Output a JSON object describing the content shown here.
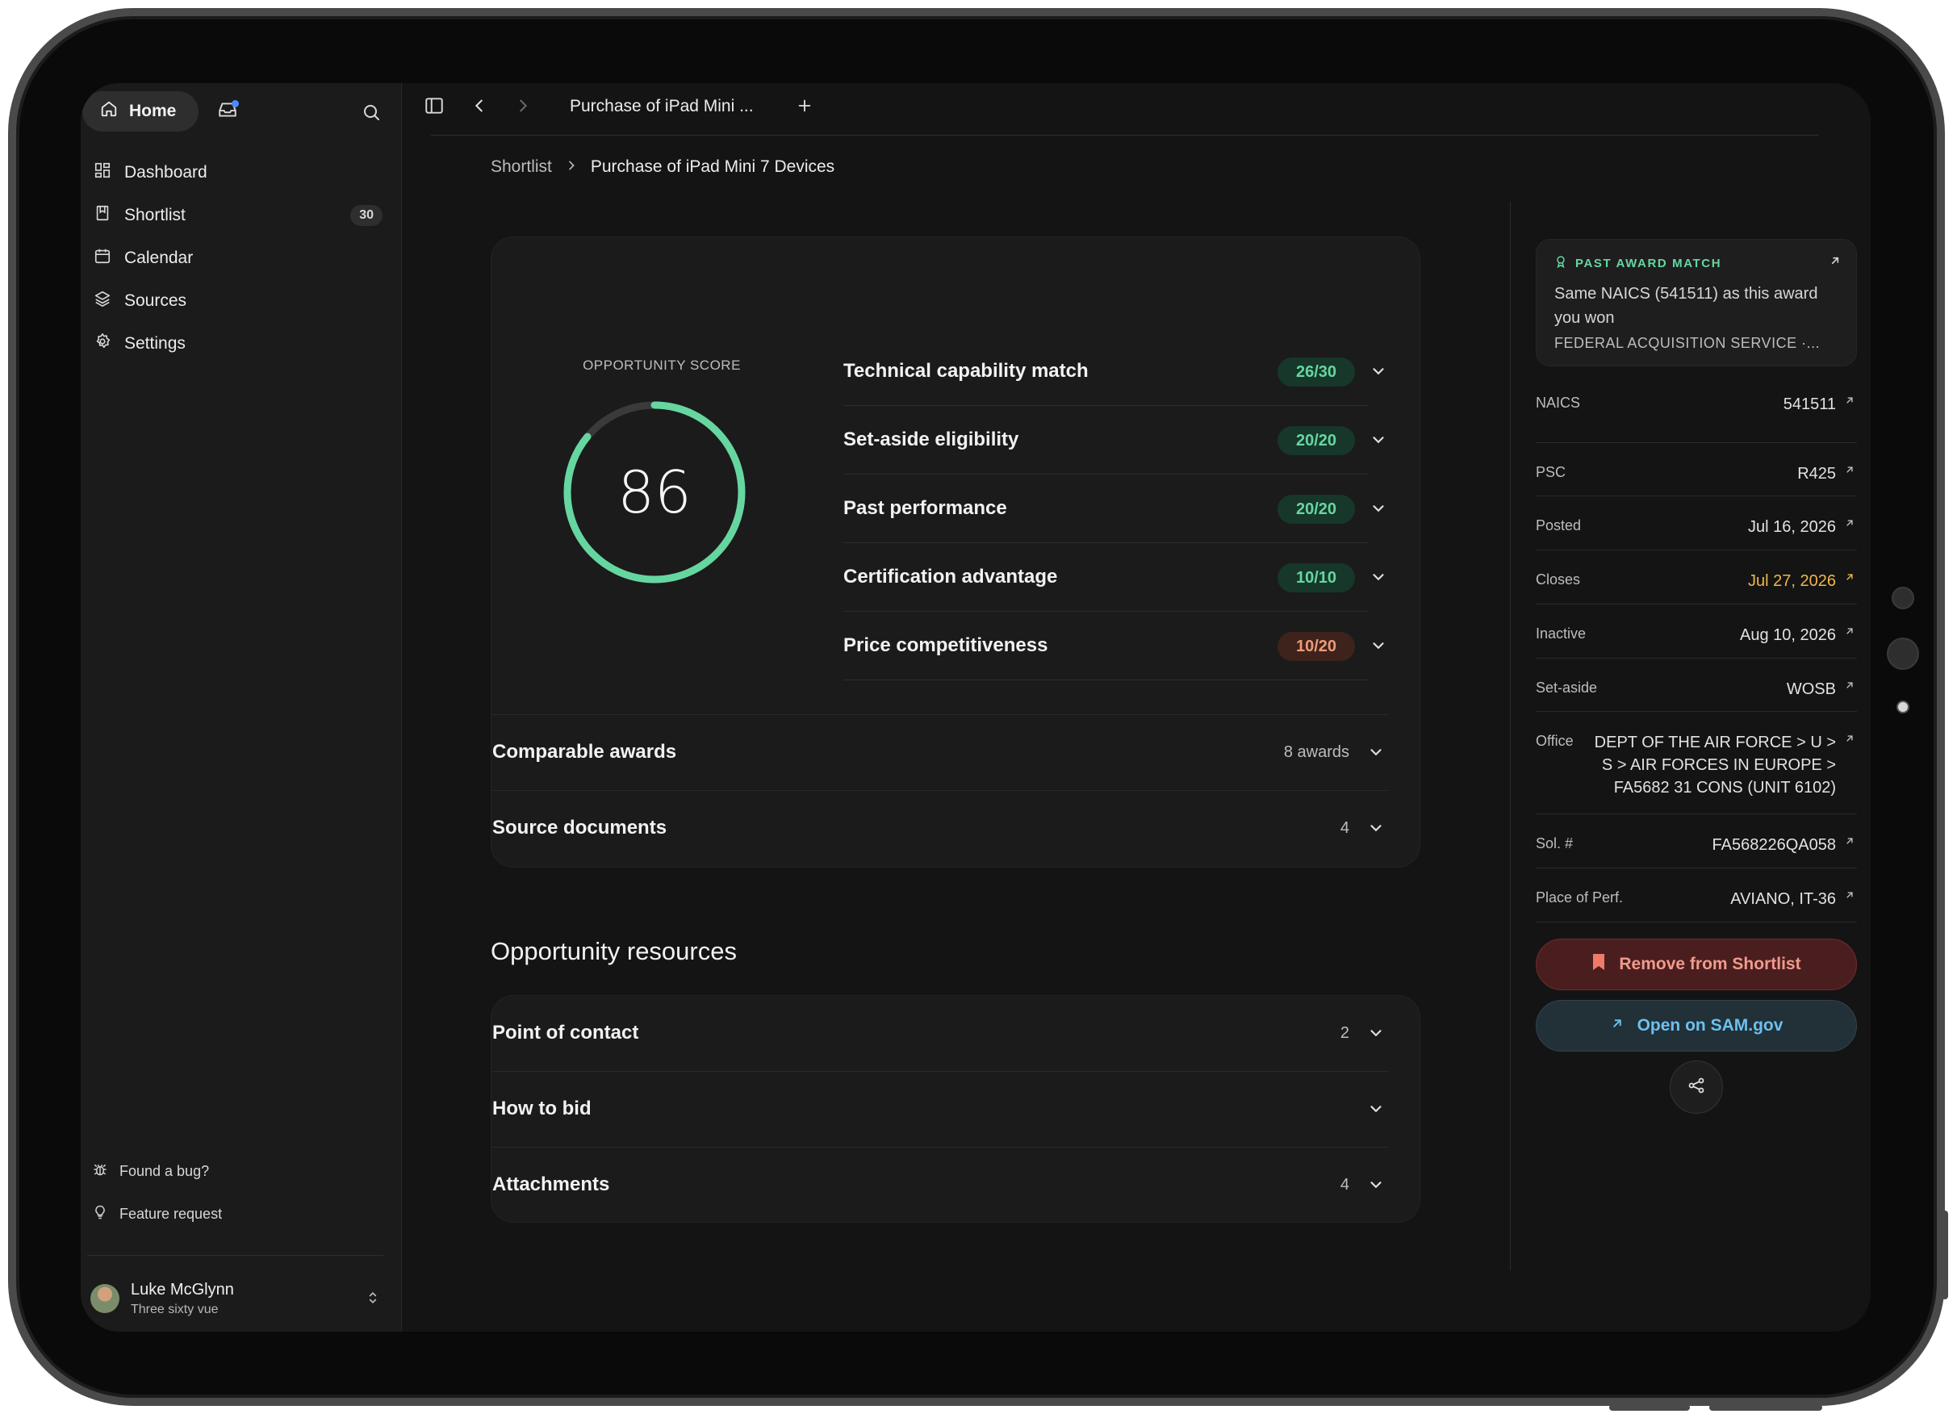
{
  "sidebar": {
    "home_label": "Home",
    "nav": [
      {
        "label": "Dashboard",
        "icon": "dashboard-icon"
      },
      {
        "label": "Shortlist",
        "icon": "bookmark-icon",
        "count": "30"
      },
      {
        "label": "Calendar",
        "icon": "calendar-icon"
      },
      {
        "label": "Sources",
        "icon": "layers-icon"
      },
      {
        "label": "Settings",
        "icon": "gear-icon"
      }
    ],
    "footer": {
      "bug_label": "Found a bug?",
      "feature_label": "Feature request"
    },
    "user": {
      "name": "Luke McGlynn",
      "org": "Three sixty vue"
    }
  },
  "topbar": {
    "tab_title": "Purchase of iPad Mini ..."
  },
  "breadcrumb": {
    "parent": "Shortlist",
    "current": "Purchase of iPad Mini 7 Devices"
  },
  "score": {
    "label": "OPPORTUNITY SCORE",
    "value": "86",
    "fraction": 0.86,
    "criteria": [
      {
        "name": "Technical capability match",
        "score": "26/30",
        "status": "good"
      },
      {
        "name": "Set-aside eligibility",
        "score": "20/20",
        "status": "good"
      },
      {
        "name": "Past performance",
        "score": "20/20",
        "status": "good"
      },
      {
        "name": "Certification advantage",
        "score": "10/10",
        "status": "good"
      },
      {
        "name": "Price competitiveness",
        "score": "10/20",
        "status": "warn"
      }
    ],
    "rows": [
      {
        "name": "Comparable awards",
        "meta": "8 awards"
      },
      {
        "name": "Source documents",
        "meta": "4"
      }
    ]
  },
  "resources": {
    "title": "Opportunity resources",
    "rows": [
      {
        "name": "Point of contact",
        "meta": "2"
      },
      {
        "name": "How to bid",
        "meta": ""
      },
      {
        "name": "Attachments",
        "meta": "4"
      }
    ]
  },
  "award_match": {
    "tag": "PAST AWARD MATCH",
    "description": "Same NAICS (541511) as this award you won",
    "agency": "FEDERAL ACQUISITION SERVICE ·..."
  },
  "details": [
    {
      "key": "NAICS",
      "value": "541511"
    },
    {
      "key": "PSC",
      "value": "R425"
    },
    {
      "key": "Posted",
      "value": "Jul 16, 2026"
    },
    {
      "key": "Closes",
      "value": "Jul 27, 2026"
    },
    {
      "key": "Inactive",
      "value": "Aug 10, 2026"
    },
    {
      "key": "Set-aside",
      "value": "WOSB"
    },
    {
      "key": "Office",
      "value": "DEPT OF THE AIR FORCE > U > S > AIR FORCES IN EUROPE > FA5682 31 CONS (UNIT 6102)"
    },
    {
      "key": "Sol. #",
      "value": "FA568226QA058"
    },
    {
      "key": "Place of Perf.",
      "value": "AVIANO, IT-36"
    }
  ],
  "actions": {
    "remove_label": "Remove from Shortlist",
    "sam_label": "Open on SAM.gov"
  },
  "colors": {
    "accent_green": "#66d6a0",
    "closes_amber": "#f2b64a",
    "danger": "#f19a8c",
    "link_blue": "#6cc0ee"
  }
}
